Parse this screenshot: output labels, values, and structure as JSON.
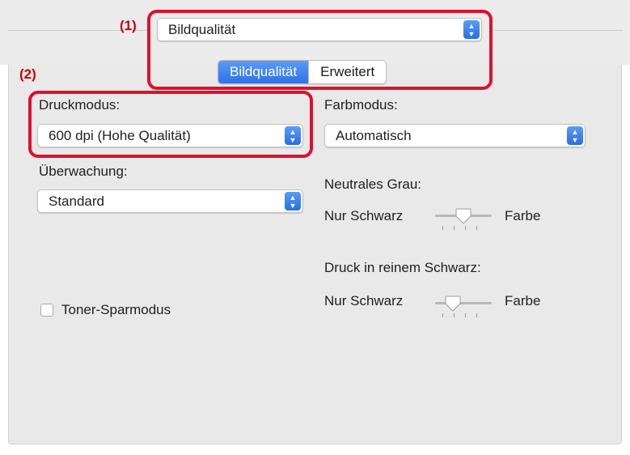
{
  "markers": {
    "one": "(1)",
    "two": "(2)"
  },
  "top_popup": {
    "value": "Bildqualität"
  },
  "tabs": [
    {
      "label": "Bildqualität",
      "active": true
    },
    {
      "label": "Erweitert",
      "active": false
    }
  ],
  "druckmodus": {
    "label": "Druckmodus:",
    "value": "600 dpi (Hohe Qualität)"
  },
  "farbmodus": {
    "label": "Farbmodus:",
    "value": "Automatisch"
  },
  "ueberwachung": {
    "label": "Überwachung:",
    "value": "Standard"
  },
  "neutrales_grau": {
    "label": "Neutrales Grau:",
    "left_label": "Nur Schwarz",
    "right_label": "Farbe",
    "level": 0.5
  },
  "reinem_schwarz": {
    "label": "Druck in reinem Schwarz:",
    "left_label": "Nur Schwarz",
    "right_label": "Farbe",
    "level": 0.25
  },
  "toner_sparmodus": {
    "label": "Toner-Sparmodus",
    "checked": false
  },
  "colors": {
    "accent": "#3478f6",
    "highlight": "#e0102c"
  }
}
